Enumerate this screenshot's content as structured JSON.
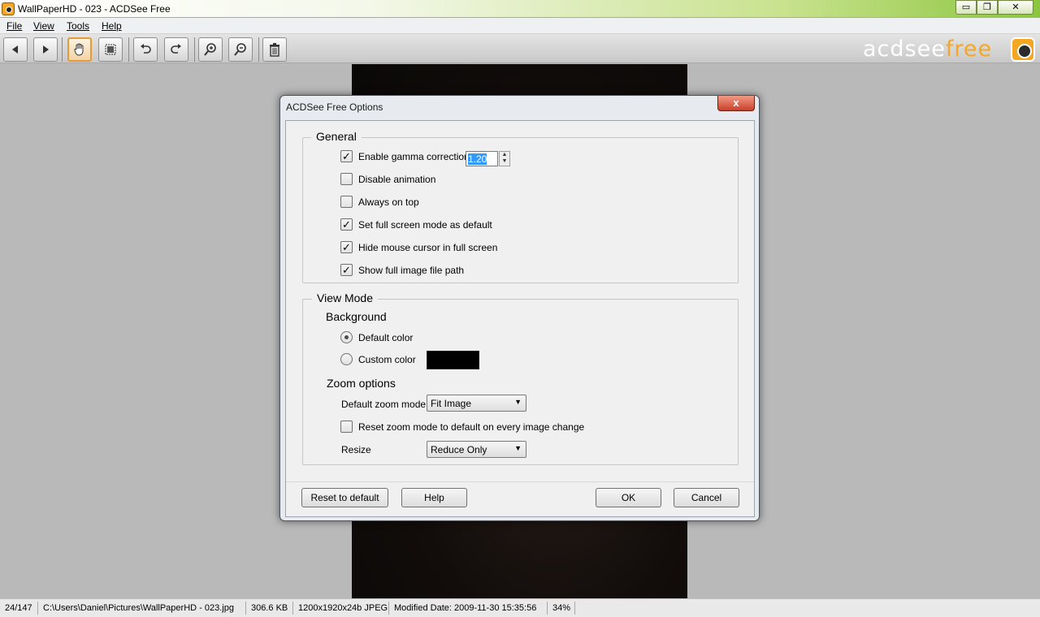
{
  "window": {
    "title": "WallPaperHD - 023 - ACDSee Free",
    "min_label": "▭",
    "max_label": "❐",
    "close_label": "✕"
  },
  "menu": {
    "items": [
      {
        "label": "File"
      },
      {
        "label": "View"
      },
      {
        "label": "Tools"
      },
      {
        "label": "Help"
      }
    ]
  },
  "toolbar": {
    "buttons": [
      {
        "icon": "previous-icon"
      },
      {
        "icon": "next-icon"
      },
      {
        "icon": "hand-icon",
        "active": true
      },
      {
        "icon": "select-icon"
      },
      {
        "icon": "rotate-left-icon"
      },
      {
        "icon": "rotate-right-icon"
      },
      {
        "icon": "zoom-in-icon"
      },
      {
        "icon": "zoom-out-icon"
      },
      {
        "icon": "delete-icon"
      }
    ]
  },
  "brand": {
    "part1": "acdsee",
    "part2": "free"
  },
  "colors": {
    "accent": "#f5a623",
    "titlebar_green": "#8cc63f",
    "custom_bg_color": "#000000"
  },
  "dialog": {
    "title": "ACDSee Free Options",
    "close_label": "x",
    "general": {
      "legend": "General",
      "gamma": {
        "label": "Enable gamma correction",
        "checked": true,
        "value": "1.20"
      },
      "options": [
        {
          "label": "Disable animation",
          "checked": false
        },
        {
          "label": "Always on top",
          "checked": false
        },
        {
          "label": "Set full screen mode as default",
          "checked": true
        },
        {
          "label": "Hide mouse cursor in full screen",
          "checked": true
        },
        {
          "label": "Show full image file path",
          "checked": true
        }
      ]
    },
    "view_mode": {
      "legend": "View Mode",
      "background_heading": "Background",
      "default_color_label": "Default color",
      "custom_color_label": "Custom color",
      "selected": "Default color",
      "zoom_heading": "Zoom options",
      "default_zoom_label": "Default zoom mode",
      "default_zoom_value": "Fit Image",
      "reset_zoom_label": "Reset zoom mode to default on every image change",
      "reset_zoom_checked": false,
      "resize_label": "Resize",
      "resize_value": "Reduce Only"
    },
    "buttons": {
      "reset": "Reset to default",
      "help": "Help",
      "ok": "OK",
      "cancel": "Cancel"
    }
  },
  "status": {
    "index": "24/147",
    "path": "C:\\Users\\Daniel\\Pictures\\WallPaperHD - 023.jpg",
    "size": "306.6 KB",
    "dimensions": "1200x1920x24b JPEG",
    "modified": "Modified Date: 2009-11-30 15:35:56",
    "zoom": "34%"
  }
}
